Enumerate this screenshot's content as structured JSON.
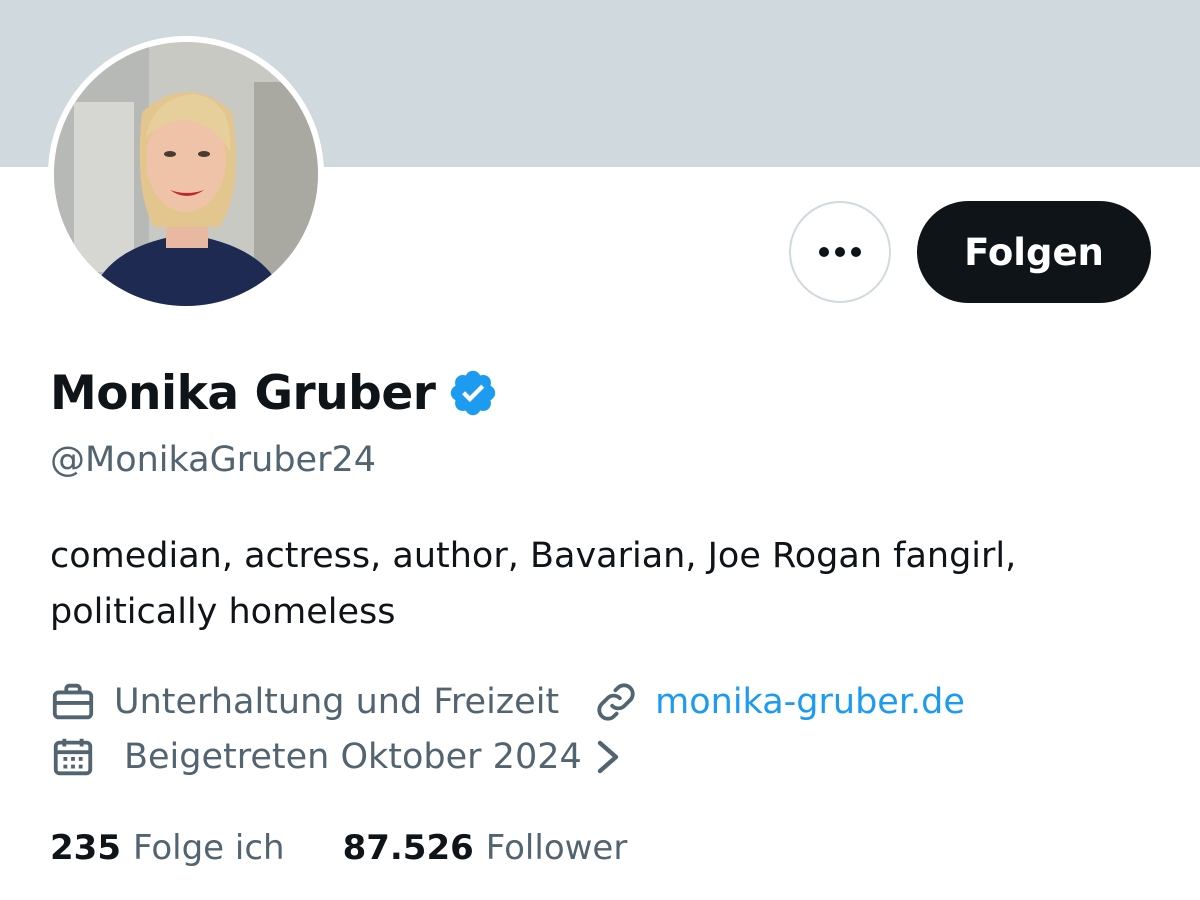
{
  "profile": {
    "name": "Monika Gruber",
    "handle": "@MonikaGruber24",
    "bio_line1": "comedian, actress, author, Bavarian, Joe Rogan fangirl,",
    "bio_line2": "politically homeless",
    "category": "Unterhaltung und Freizeit",
    "website": "monika-gruber.de",
    "joined": "Beigetreten Oktober 2024"
  },
  "actions": {
    "follow_label": "Folgen"
  },
  "stats": {
    "following_count": "235",
    "following_label": "Folge ich",
    "followers_count": "87.526",
    "followers_label": "Follower"
  },
  "icons": {
    "more": "more-horizontal-icon",
    "verified": "verified-badge-icon",
    "category": "briefcase-icon",
    "website": "link-icon",
    "joined": "calendar-icon",
    "joined_chevron": "chevron-right-icon"
  },
  "colors": {
    "banner": "#cfd9de",
    "text_primary": "#0f1419",
    "text_secondary": "#536471",
    "link": "#1d9bf0",
    "verified": "#1d9bf0",
    "follow_button_bg": "#0f1419"
  }
}
